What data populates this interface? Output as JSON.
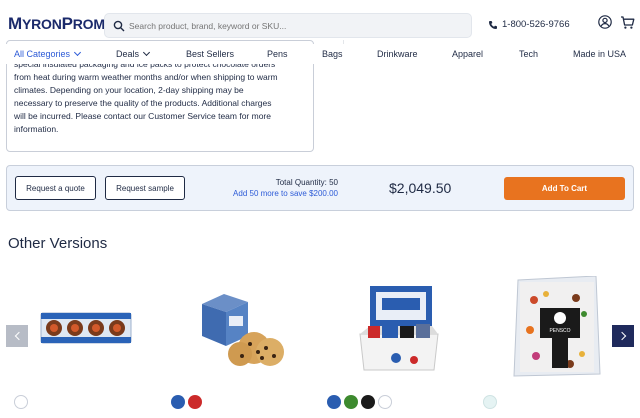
{
  "brand": {
    "logo_text_1": "M",
    "logo_text_2": "YRON",
    "logo_text_3": "P",
    "logo_text_4": "ROMOS"
  },
  "search": {
    "placeholder": "Search product, brand, keyword or SKU..."
  },
  "header": {
    "phone": "1-800-526-9766"
  },
  "nav": {
    "items": [
      {
        "label": "All Categories"
      },
      {
        "label": "Deals"
      },
      {
        "label": "Best Sellers"
      },
      {
        "label": "Pens"
      },
      {
        "label": "Bags"
      },
      {
        "label": "Drinkware"
      },
      {
        "label": "Apparel"
      },
      {
        "label": "Tech"
      },
      {
        "label": "Made in USA"
      }
    ]
  },
  "description": {
    "lines": [
      "special insulated packaging and ice packs to protect chocolate orders",
      "from heat during warm weather months and/or when shipping to warm",
      "climates. Depending on your location, 2-day shipping may be",
      "necessary to preserve the quality of the products. Additional charges",
      "will be incurred. Please contact our Customer Service team for more",
      "information."
    ]
  },
  "quote_bar": {
    "request_quote": "Request a quote",
    "request_sample": "Request sample",
    "total_quantity_label": "Total Quantity:",
    "total_quantity_value": "50",
    "save_message": "Add 50 more to save $200.00",
    "price": "$2,049.50",
    "add_to_cart": "Add To Cart"
  },
  "other_versions": {
    "title": "Other Versions",
    "products": [
      {
        "name": "chocolate-tin-product",
        "swatches": [
          "#ffffff"
        ]
      },
      {
        "name": "cookie-box-product",
        "swatches": [
          "#2a5db0",
          "#cc2a2a"
        ]
      },
      {
        "name": "gift-box-product",
        "swatches": [
          "#2a5db0",
          "#3d8a2e",
          "#1a1a1a",
          "#ffffff"
        ]
      },
      {
        "name": "snack-bag-product",
        "swatches": [
          "#e5f3f3"
        ]
      }
    ]
  },
  "colors": {
    "accent": "#2d5bd7",
    "brand_navy": "#1b2a6b",
    "cart_orange": "#e8731f",
    "quote_bar_bg": "#eef3fb"
  }
}
